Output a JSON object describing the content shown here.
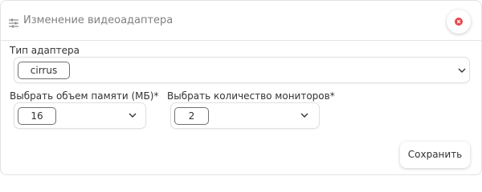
{
  "dialog": {
    "title": "Изменение видеоадаптера",
    "title_icon": "sliders-icon",
    "close_icon": "close-icon",
    "accent_color": "#e5484d"
  },
  "form": {
    "adapter_type": {
      "label": "Тип адаптера",
      "value": "cirrus"
    },
    "memory": {
      "label": "Выбрать объем памяти (МБ)*",
      "value": "16"
    },
    "monitors": {
      "label": "Выбрать количество мониторов*",
      "value": "2"
    }
  },
  "actions": {
    "save_label": "Сохранить"
  }
}
